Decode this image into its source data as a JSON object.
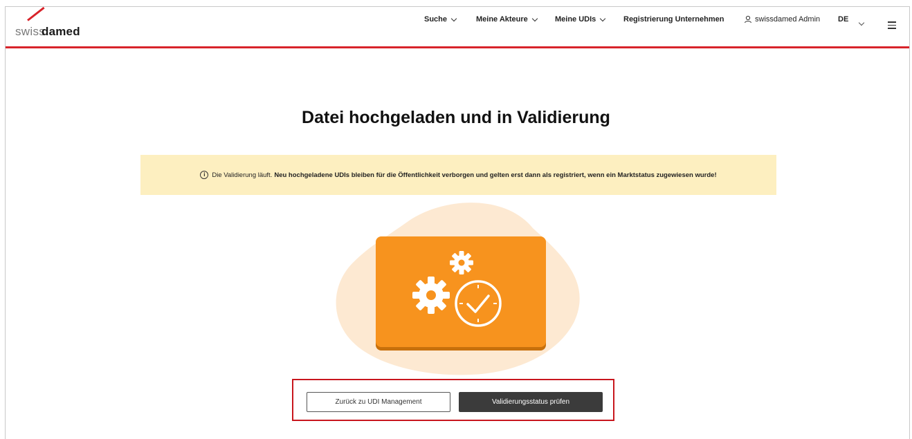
{
  "header": {
    "logo": {
      "part1": "swiss",
      "part2": "damed"
    },
    "nav": [
      {
        "label": "Suche",
        "has_dropdown": true
      },
      {
        "label": "Meine Akteure",
        "has_dropdown": true
      },
      {
        "label": "Meine UDIs",
        "has_dropdown": true
      },
      {
        "label": "Registrierung Unternehmen",
        "has_dropdown": false
      }
    ],
    "user": {
      "label": "swissdamed Admin",
      "icon": "user-icon"
    },
    "language": {
      "label": "DE",
      "icon": "chevron-down-icon"
    },
    "menu_icon": "hamburger-menu-icon",
    "accent_color": "#d8232a"
  },
  "main": {
    "title": "Datei hochgeladen und in Validierung",
    "notice": {
      "icon": "info-icon",
      "lead": "Die Validierung läuft.",
      "bold": "Neu hochgeladene UDIs bleiben für die Öffentlichkeit verborgen und gelten erst dann als registriert, wenn ein Marktstatus zugewiesen wurde!",
      "background": "#fdefc0"
    },
    "illustration": {
      "icons": [
        "gears-icon",
        "clock-check-icon"
      ],
      "card_color": "#f7931e"
    },
    "buttons": {
      "back": "Zurück zu UDI Management",
      "check": "Validierungsstatus prüfen"
    }
  }
}
